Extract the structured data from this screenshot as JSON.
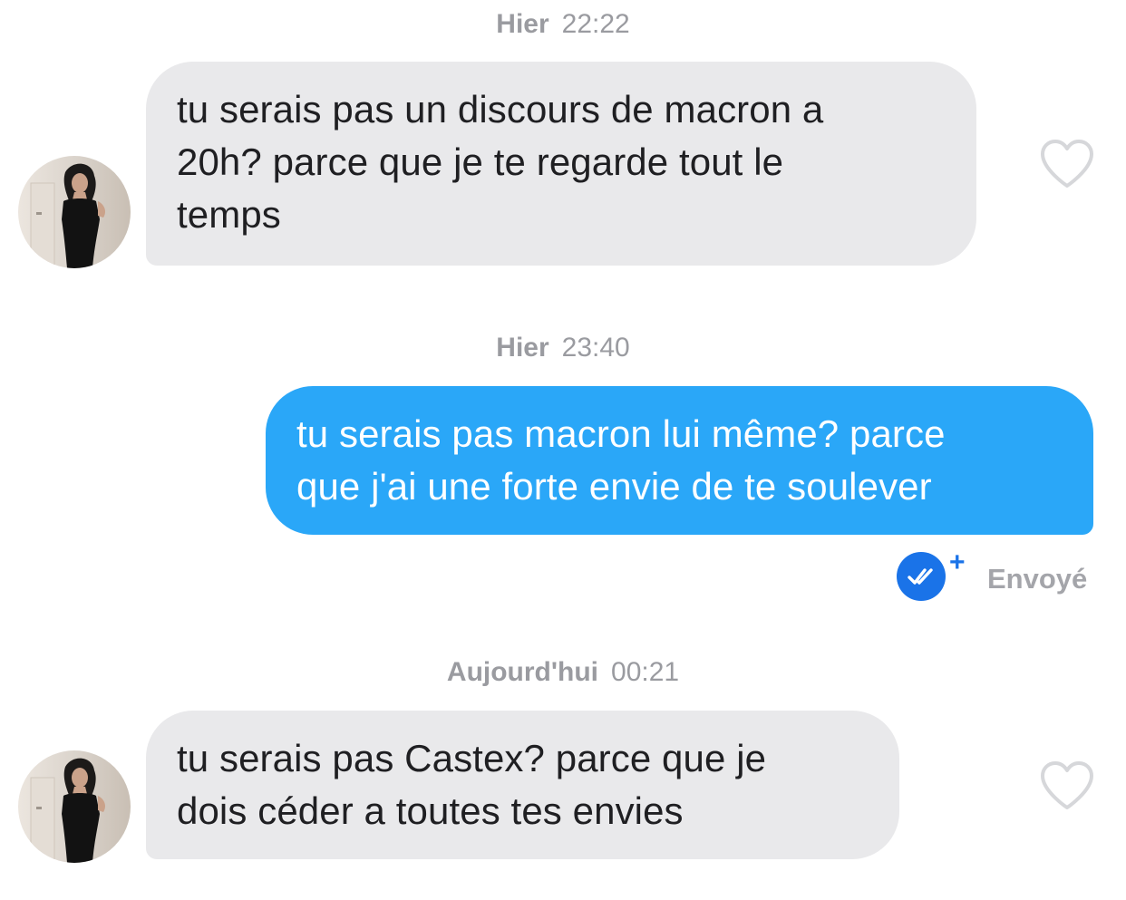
{
  "conversation": {
    "groups": [
      {
        "day": "Hier",
        "time": "22:22",
        "message": {
          "direction": "received",
          "text": "tu serais pas un discours de macron a\n20h? parce que je te regarde tout le\ntemps"
        }
      },
      {
        "day": "Hier",
        "time": "23:40",
        "message": {
          "direction": "sent",
          "text": "tu serais pas macron lui même? parce\nque j'ai une forte envie de te soulever"
        },
        "receipt": {
          "status": "Envoyé",
          "icon": "double-check-icon",
          "plus": "+"
        }
      },
      {
        "day": "Aujourd'hui",
        "time": "00:21",
        "message": {
          "direction": "received",
          "text": "tu serais pas Castex? parce que je\ndois céder a toutes tes envies"
        }
      }
    ]
  },
  "colors": {
    "received_bubble": "#e9e9eb",
    "sent_bubble": "#2aa7f8",
    "timestamp_text": "#9a9ba0",
    "receipt_blue": "#1a73e8",
    "heart_outline": "#d6d7da"
  },
  "icons": {
    "like": "heart-outline-icon",
    "avatar": "profile-photo"
  }
}
